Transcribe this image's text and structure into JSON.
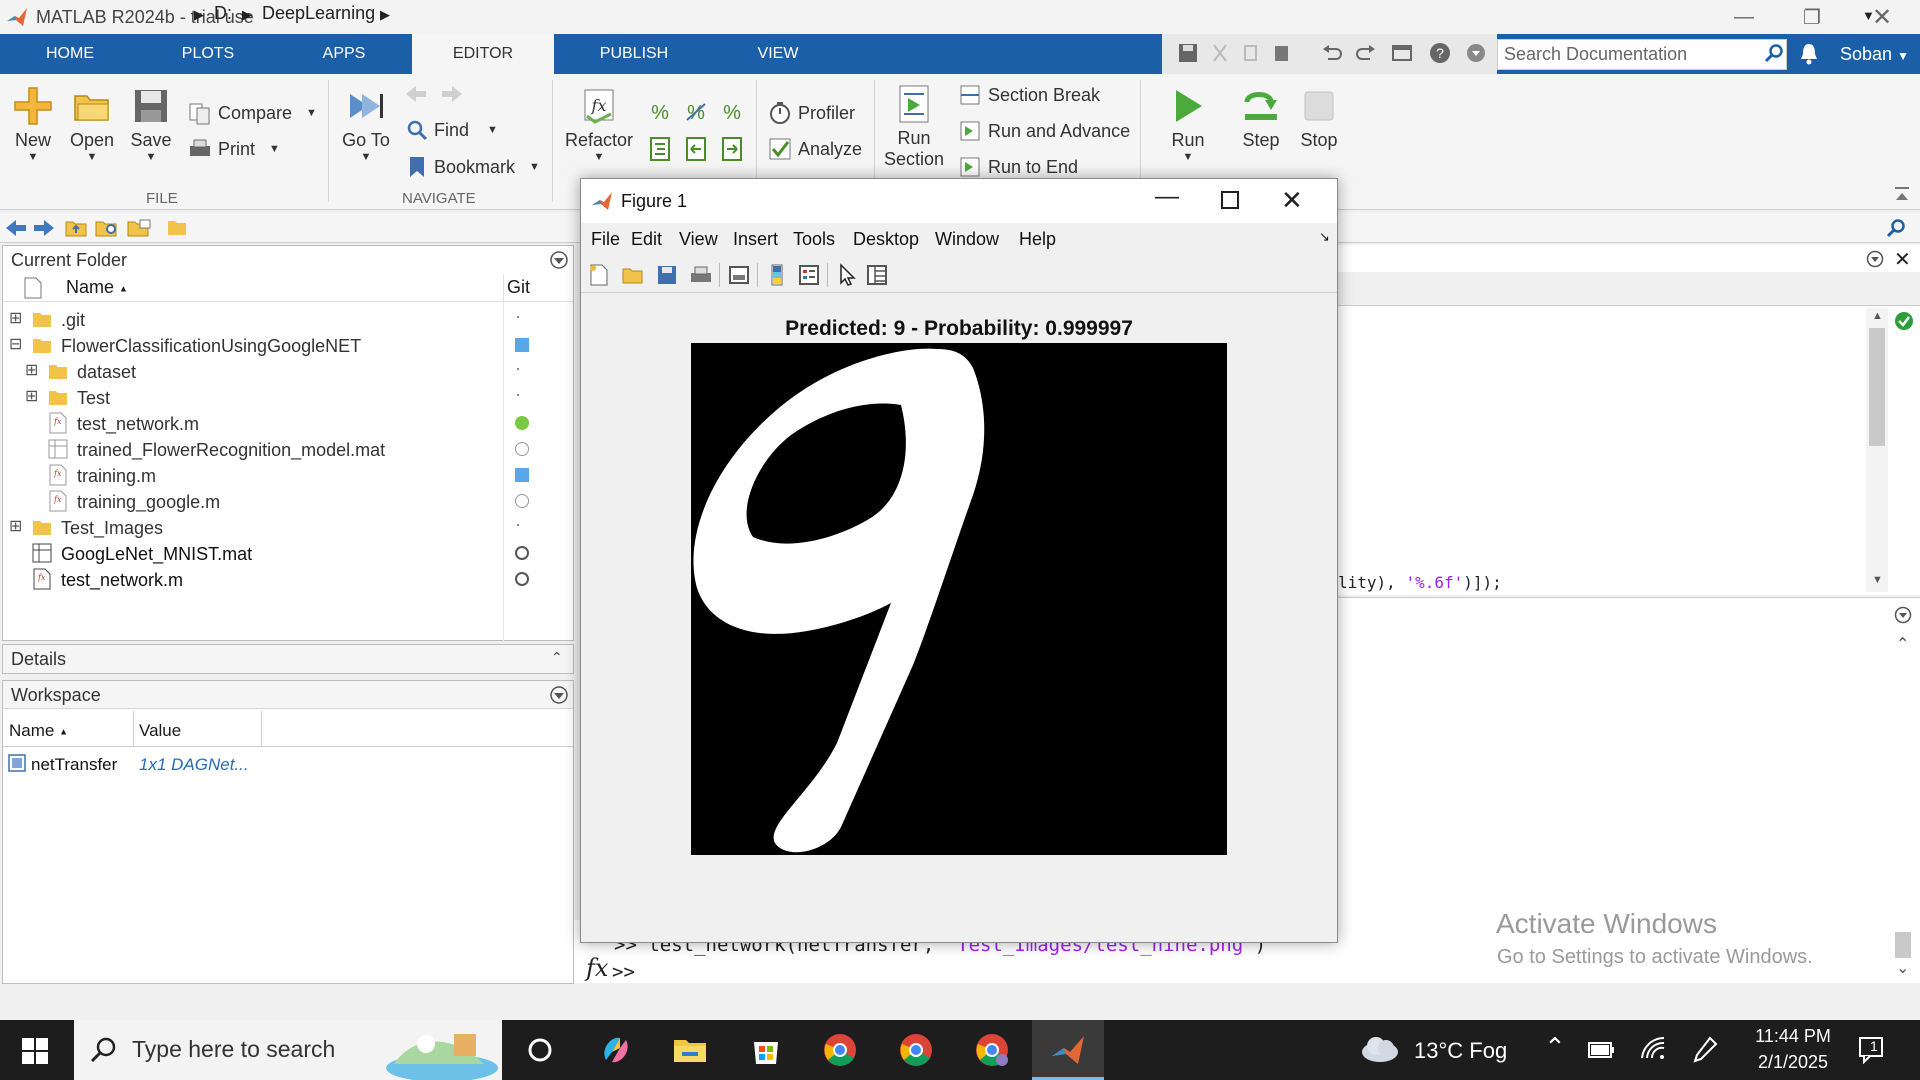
{
  "window": {
    "title": "MATLAB R2024b - trial use"
  },
  "tabs": [
    {
      "label": "HOME"
    },
    {
      "label": "PLOTS"
    },
    {
      "label": "APPS"
    },
    {
      "label": "EDITOR"
    },
    {
      "label": "PUBLISH"
    },
    {
      "label": "VIEW"
    }
  ],
  "search_doc": {
    "placeholder": "Search Documentation"
  },
  "user": {
    "name": "Soban"
  },
  "ribbon": {
    "new": "New",
    "open": "Open",
    "save": "Save",
    "compare": "Compare",
    "print": "Print",
    "file_group": "FILE",
    "goto": "Go To",
    "find": "Find",
    "bookmark": "Bookmark",
    "navigate_group": "NAVIGATE",
    "refactor": "Refactor",
    "profiler": "Profiler",
    "analyze": "Analyze",
    "run_section_1": "Run",
    "run_section_2": "Section",
    "section_break": "Section Break",
    "run_advance": "Run and Advance",
    "run_end": "Run to End",
    "run": "Run",
    "step": "Step",
    "stop": "Stop"
  },
  "address": {
    "drive": "D:",
    "folder": "DeepLearning"
  },
  "current_folder": {
    "title": "Current Folder",
    "col_name": "Name",
    "col_git": "Git",
    "rows": [
      {
        "name": ".git"
      },
      {
        "name": "FlowerClassificationUsingGoogleNET"
      },
      {
        "name": "dataset"
      },
      {
        "name": "Test"
      },
      {
        "name": "test_network.m"
      },
      {
        "name": "trained_FlowerRecognition_model.mat"
      },
      {
        "name": "training.m"
      },
      {
        "name": "training_google.m"
      },
      {
        "name": "Test_Images"
      },
      {
        "name": "GoogLeNet_MNIST.mat"
      },
      {
        "name": "test_network.m"
      }
    ]
  },
  "details": {
    "title": "Details"
  },
  "workspace": {
    "title": "Workspace",
    "col_name": "Name",
    "col_value": "Value",
    "rows": [
      {
        "name": "netTransfer",
        "value": "1x1 DAGNet..."
      }
    ]
  },
  "editor": {
    "code_line_a": "lity), ",
    "code_line_b": "'%.6f'",
    "code_line_c": ")]);"
  },
  "command": {
    "history_prompt": ">> test_network(netTransfer, ",
    "history_arg": "'Test_Images/test_nine.png'",
    "history_end": ")",
    "fx": "fx",
    "prompt": ">>"
  },
  "activate": {
    "line1": "Activate Windows",
    "line2": "Go to Settings to activate Windows."
  },
  "figure": {
    "title": "Figure 1",
    "menu": [
      "File",
      "Edit",
      "View",
      "Insert",
      "Tools",
      "Desktop",
      "Window",
      "Help"
    ],
    "plot_title": "Predicted: 9 - Probability: 0.999997"
  },
  "taskbar": {
    "search_placeholder": "Type here to search",
    "weather": "13°C  Fog",
    "time": "11:44 PM",
    "date": "2/1/2025",
    "notifications": "1"
  },
  "colors": {
    "ribbon_blue": "#1a5fa8",
    "git_green": "#7ac943",
    "git_blue": "#5aa7e8",
    "taskbar": "#1d1d1d"
  }
}
